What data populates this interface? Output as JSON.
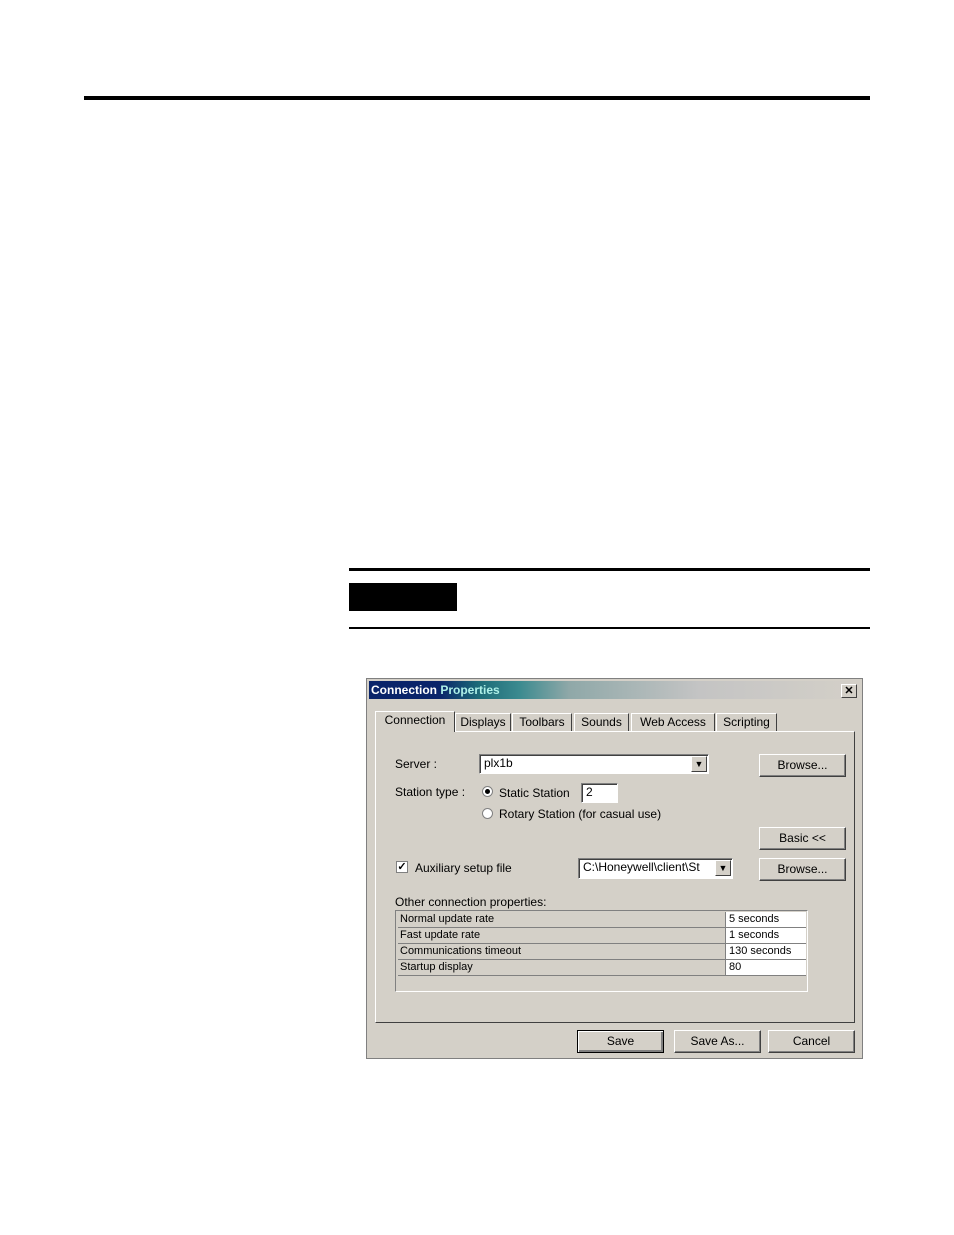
{
  "dialog": {
    "title_part1": "Connection",
    "title_part2": "Properties",
    "close_label": "✕",
    "tabs": [
      "Connection",
      "Displays",
      "Toolbars",
      "Sounds",
      "Web Access",
      "Scripting"
    ],
    "server_label": "Server :",
    "server_value": "plx1b",
    "browse_label": "Browse...",
    "station_type_label": "Station type :",
    "static_station_label": "Static Station",
    "static_station_value": "2",
    "rotary_station_label": "Rotary Station (for casual use)",
    "basic_button": "Basic <<",
    "aux_setup_label": "Auxiliary setup file",
    "aux_setup_checked": true,
    "aux_setup_value": "C:\\Honeywell\\client\\St",
    "browse2_label": "Browse...",
    "other_props_label": "Other connection properties:",
    "properties": [
      {
        "name": "Normal update rate",
        "value": "5  seconds"
      },
      {
        "name": "Fast update rate",
        "value": "1  seconds"
      },
      {
        "name": "Communications timeout",
        "value": "130 seconds"
      },
      {
        "name": "Startup display",
        "value": "80"
      }
    ],
    "buttons": {
      "save": "Save",
      "save_as": "Save As...",
      "cancel": "Cancel"
    }
  },
  "colors": {
    "title_active": "#0a246a",
    "face": "#d4d0c8"
  }
}
